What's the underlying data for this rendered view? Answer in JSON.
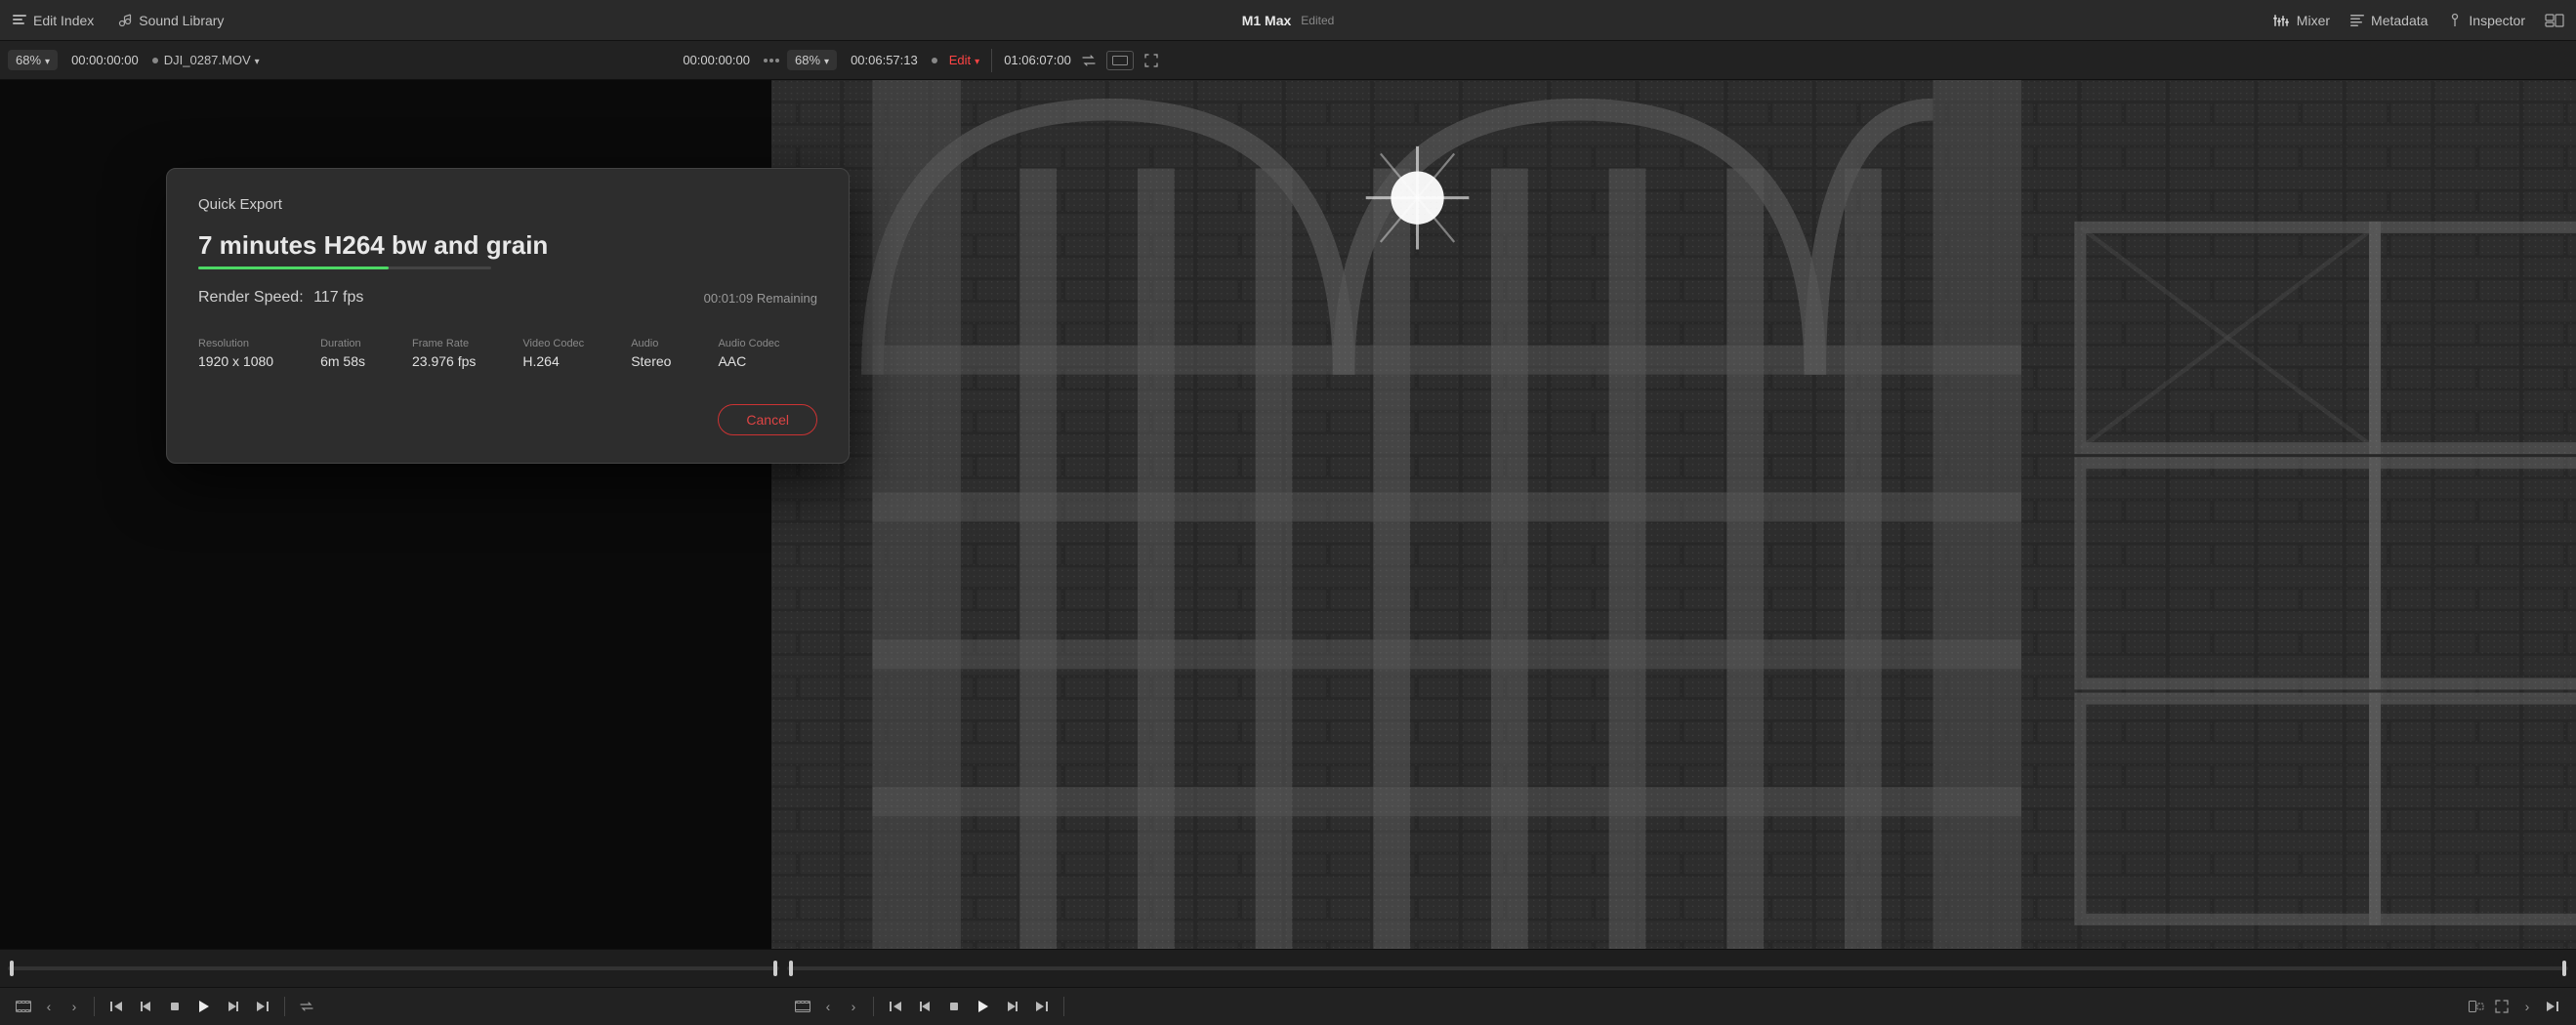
{
  "topbar": {
    "edit_index_label": "Edit Index",
    "sound_library_label": "Sound Library",
    "title": "M1 Max",
    "edited": "Edited",
    "mixer_label": "Mixer",
    "metadata_label": "Metadata",
    "inspector_label": "Inspector"
  },
  "timecode_bar": {
    "left": {
      "zoom": "68%",
      "timecode": "00:00:00:00",
      "filename": "DJI_0287.MOV",
      "center_timecode": "00:00:00:00"
    },
    "right": {
      "zoom": "68%",
      "duration": "00:06:57:13",
      "edit_label": "Edit",
      "end_time": "01:06:07:00"
    }
  },
  "dialog": {
    "title": "Quick Export",
    "export_name": "7 minutes H264 bw and grain",
    "progress_percent": 65,
    "render_speed_label": "Render Speed:",
    "render_speed_value": "117 fps",
    "remaining_time": "00:01:09 Remaining",
    "meta": {
      "resolution_label": "Resolution",
      "resolution_value": "1920 x 1080",
      "duration_label": "Duration",
      "duration_value": "6m 58s",
      "framerate_label": "Frame Rate",
      "framerate_value": "23.976 fps",
      "video_codec_label": "Video Codec",
      "video_codec_value": "H.264",
      "audio_label": "Audio",
      "audio_value": "Stereo",
      "audio_codec_label": "Audio Codec",
      "audio_codec_value": "AAC"
    },
    "cancel_label": "Cancel"
  },
  "colors": {
    "accent_red": "#ff4444",
    "progress_green": "#4cd964",
    "cancel_border": "#cc3333"
  }
}
